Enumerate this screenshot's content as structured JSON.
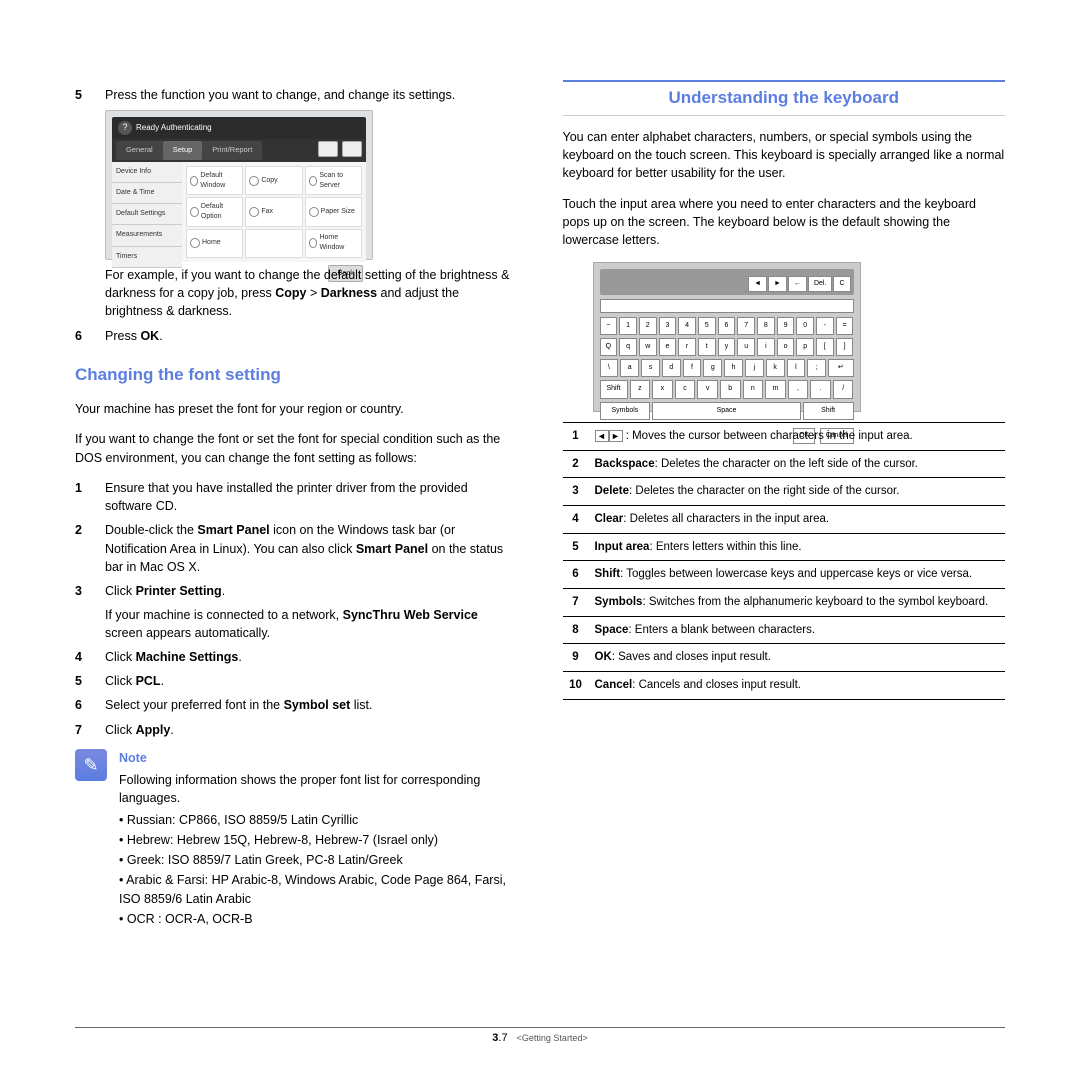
{
  "left": {
    "step5_num": "5",
    "step5": "Press the function you want to change, and change its settings.",
    "ss1": {
      "header_title": "Ready\nAuthenticating",
      "tabs": [
        "General",
        "Setup",
        "Print/Report"
      ],
      "side": [
        "Device Info",
        "Date & Time",
        "Default Settings",
        "Measurements",
        "Timers"
      ],
      "cells": [
        "Default Window",
        "Copy",
        "Scan to Server",
        "Default Option",
        "Fax",
        "Paper Size",
        "Home",
        "",
        "Home Window"
      ],
      "back": "Back"
    },
    "example_a": "For example, if you want to change the default setting of the brightness & darkness for a copy job, press ",
    "example_b": "Copy",
    "example_c": " > ",
    "example_d": "Darkness",
    "example_e": " and adjust the brightness & darkness.",
    "step6_num": "6",
    "step6_a": "Press ",
    "step6_b": "OK",
    "step6_c": ".",
    "section1": "Changing the font setting",
    "p1": "Your machine has preset the font for your region or country.",
    "p2": "If you want to change the font or set the font for special condition such as the DOS environment, you can change the font setting as follows:",
    "s1_num": "1",
    "s1": "Ensure that you have installed the printer driver from the provided software CD.",
    "s2_num": "2",
    "s2_a": "Double-click the ",
    "s2_b": "Smart Panel",
    "s2_c": " icon on the Windows task bar (or Notification Area in Linux). You can also click ",
    "s2_d": "Smart Panel",
    "s2_e": " on the status bar in Mac OS X.",
    "s3_num": "3",
    "s3_a": "Click ",
    "s3_b": "Printer Setting",
    "s3_c": ".",
    "s3_note_a": "If your machine is connected to a network, ",
    "s3_note_b": "SyncThru Web Service",
    "s3_note_c": " screen appears automatically.",
    "s4_num": "4",
    "s4_a": "Click ",
    "s4_b": "Machine Settings",
    "s4_c": ".",
    "s5_num": "5",
    "s5_a": "Click ",
    "s5_b": "PCL",
    "s5_c": ".",
    "s6_num": "6",
    "s6_a": "Select your preferred font in the ",
    "s6_b": "Symbol set",
    "s6_c": " list.",
    "s7_num": "7",
    "s7_a": "Click ",
    "s7_b": "Apply",
    "s7_c": ".",
    "note_label": "Note",
    "note_body": "Following information shows the proper font list for corresponding languages.",
    "bullets": [
      "Russian: CP866, ISO 8859/5 Latin Cyrillic",
      "Hebrew: Hebrew 15Q, Hebrew-8, Hebrew-7 (Israel only)",
      "Greek: ISO 8859/7 Latin Greek, PC-8 Latin/Greek",
      "Arabic & Farsi: HP Arabic-8, Windows Arabic, Code Page 864, Farsi, ISO 8859/6 Latin Arabic",
      "OCR : OCR-A, OCR-B"
    ]
  },
  "right": {
    "section": "Understanding the keyboard",
    "p1": "You can enter alphabet characters, numbers, or special symbols using the keyboard on the touch screen. This keyboard is specially arranged like a normal keyboard for better usability for the user.",
    "p2": "Touch the input area where you need to enter characters and the keyboard pops up on the screen. The keyboard below is the default showing the lowercase letters.",
    "kb_top": [
      "◄",
      "►",
      "←",
      "Del.",
      "C"
    ],
    "kb_num": [
      "~",
      "1",
      "2",
      "3",
      "4",
      "5",
      "6",
      "7",
      "8",
      "9",
      "0",
      "-",
      "="
    ],
    "kb_q": [
      "Q",
      "q",
      "w",
      "e",
      "r",
      "t",
      "y",
      "u",
      "i",
      "o",
      "p",
      "[",
      "]"
    ],
    "kb_a": [
      "\\",
      "a",
      "s",
      "d",
      "f",
      "g",
      "h",
      "j",
      "k",
      "l",
      ";",
      "↵"
    ],
    "kb_z": [
      "Shift",
      "z",
      "x",
      "c",
      "v",
      "b",
      "n",
      "m",
      ",",
      ".",
      "/"
    ],
    "kb_sp": [
      "Symbols",
      "Space",
      "Shift"
    ],
    "kb_ok": "OK",
    "kb_cancel": "Cancel",
    "rows": [
      {
        "n": "1",
        "desc": ": Moves the cursor between characters in the input area.",
        "arrows": true
      },
      {
        "n": "2",
        "b": "Backspace",
        "desc": ": Deletes the character on the left side of the cursor."
      },
      {
        "n": "3",
        "b": "Delete",
        "desc": ": Deletes the character on the right side of the cursor."
      },
      {
        "n": "4",
        "b": "Clear",
        "desc": ": Deletes all characters in the input area."
      },
      {
        "n": "5",
        "b": "Input area",
        "desc": ": Enters letters within this line."
      },
      {
        "n": "6",
        "b": "Shift",
        "desc": ": Toggles between lowercase keys and uppercase keys or vice versa."
      },
      {
        "n": "7",
        "b": "Symbols",
        "desc": ": Switches from the alphanumeric keyboard to the symbol keyboard."
      },
      {
        "n": "8",
        "b": "Space",
        "desc": ": Enters a blank between characters."
      },
      {
        "n": "9",
        "b": "OK",
        "desc": ": Saves and closes input result."
      },
      {
        "n": "10",
        "b": "Cancel",
        "desc": ": Cancels and closes input result."
      }
    ]
  },
  "footer": {
    "chapter": "3",
    "page": ".7",
    "section": "<Getting Started>"
  }
}
